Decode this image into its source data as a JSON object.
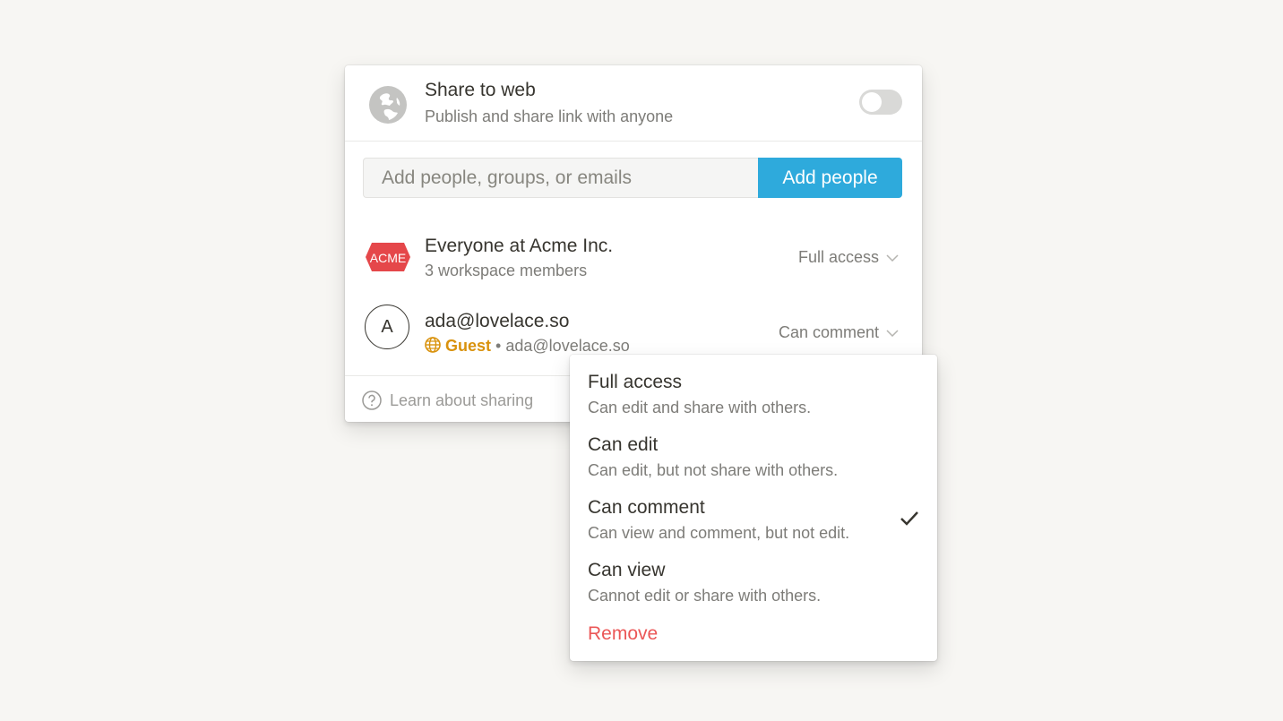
{
  "share_panel": {
    "share_to_web": {
      "icon": "globe-icon",
      "title": "Share to web",
      "subtitle": "Publish and share link with anyone",
      "toggle_on": false
    },
    "invite": {
      "placeholder": "Add people, groups, or emails",
      "value": "",
      "button_label": "Add people"
    },
    "members": [
      {
        "avatar": "acme-logo",
        "avatar_text": "ACME",
        "name": "Everyone at Acme Inc.",
        "subtitle": "3 workspace members",
        "role": "Full access"
      },
      {
        "avatar": "letter-avatar",
        "avatar_text": "A",
        "name": "ada@lovelace.so",
        "badge": "Guest",
        "separator": "•",
        "subtitle": "ada@lovelace.so",
        "role": "Can comment"
      }
    ],
    "footer": {
      "learn_label": "Learn about sharing"
    }
  },
  "role_menu": {
    "options": [
      {
        "label": "Full access",
        "description": "Can edit and share with others.",
        "selected": false
      },
      {
        "label": "Can edit",
        "description": "Can edit, but not share with others.",
        "selected": false
      },
      {
        "label": "Can comment",
        "description": "Can view and comment, but not edit.",
        "selected": true
      },
      {
        "label": "Can view",
        "description": "Cannot edit or share with others.",
        "selected": false
      }
    ],
    "remove_label": "Remove"
  },
  "colors": {
    "accent": "#2eaadc",
    "guest": "#d9920d",
    "danger": "#eb5757",
    "acme": "#e5474a",
    "background": "#f7f6f3"
  }
}
